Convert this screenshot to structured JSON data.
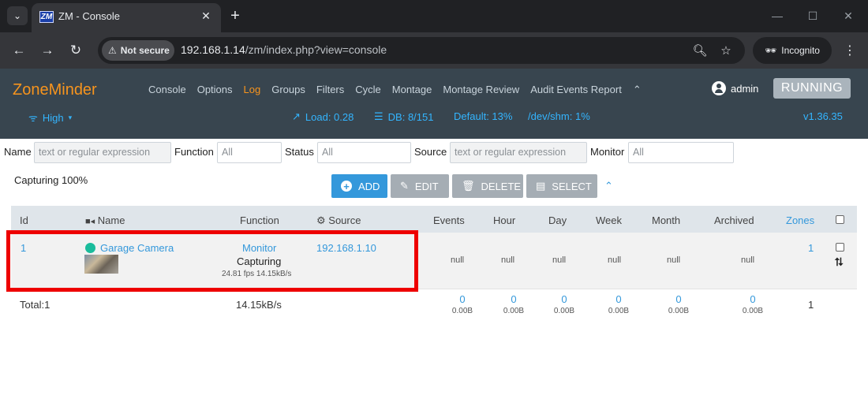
{
  "browser": {
    "tab_title": "ZM - Console",
    "favicon_text": "ZM",
    "security_label": "Not secure",
    "url_host": "192.168.1.14",
    "url_path": "/zm/index.php?view=console",
    "incognito_label": "Incognito"
  },
  "navbar": {
    "brand": "ZoneMinder",
    "menu": [
      "Console",
      "Options",
      "Log",
      "Groups",
      "Filters",
      "Cycle",
      "Montage",
      "Montage Review",
      "Audit Events Report"
    ],
    "active_item": "Log",
    "user": "admin",
    "state_button": "RUNNING",
    "bandwidth": "High",
    "load": "Load: 0.28",
    "db": "DB: 8/151",
    "default_disk": "Default: 13%",
    "shm": "/dev/shm: 1%",
    "version": "v1.36.35",
    "colors": {
      "brand": "#f7941d",
      "link": "#33b5ff",
      "navbar_bg": "#38454f"
    }
  },
  "filters": {
    "name_label": "Name",
    "name_placeholder": "text or regular expression",
    "function_label": "Function",
    "function_value": "All",
    "status_label": "Status",
    "status_value": "All",
    "source_label": "Source",
    "source_placeholder": "text or regular expression",
    "monitor_label": "Monitor",
    "monitor_value": "All"
  },
  "capturing_status": "Capturing 100%",
  "actions": {
    "add": "ADD",
    "edit": "EDIT",
    "delete": "DELETE",
    "select": "SELECT"
  },
  "table": {
    "headers": {
      "id": "Id",
      "name": "Name",
      "function": "Function",
      "source": "Source",
      "events": "Events",
      "hour": "Hour",
      "day": "Day",
      "week": "Week",
      "month": "Month",
      "archived": "Archived",
      "zones": "Zones"
    },
    "monitor": {
      "id": "1",
      "name": "Garage Camera",
      "function": "Monitor",
      "state": "Capturing",
      "stats": "24.81 fps 14.15kB/s",
      "source": "192.168.1.10",
      "events": "null",
      "hour": "null",
      "day": "null",
      "week": "null",
      "month": "null",
      "archived": "null",
      "zones": "1"
    },
    "totals": {
      "label": "Total:1",
      "bandwidth": "14.15kB/s",
      "events": {
        "count": "0",
        "size": "0.00B"
      },
      "hour": {
        "count": "0",
        "size": "0.00B"
      },
      "day": {
        "count": "0",
        "size": "0.00B"
      },
      "week": {
        "count": "0",
        "size": "0.00B"
      },
      "month": {
        "count": "0",
        "size": "0.00B"
      },
      "archived": {
        "count": "0",
        "size": "0.00B"
      },
      "zones": "1"
    }
  }
}
